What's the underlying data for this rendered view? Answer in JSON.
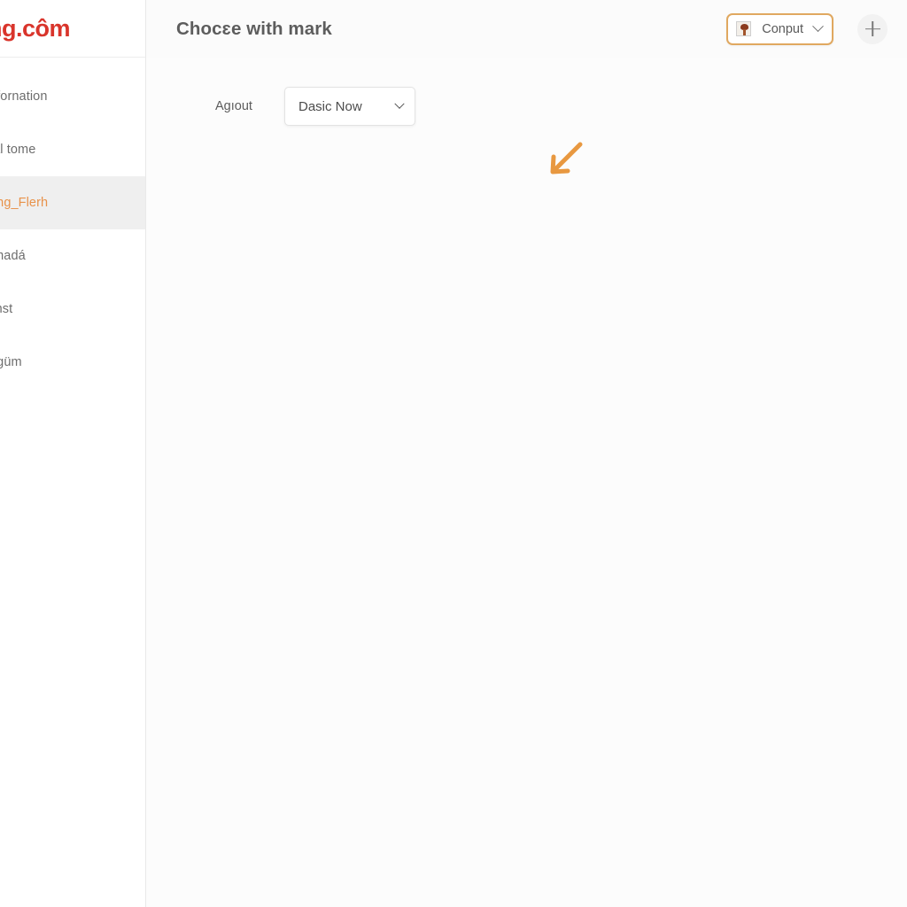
{
  "brand": {
    "logo_text": "ng.côm",
    "logo_color": "#d9342b"
  },
  "sidebar": {
    "items": [
      {
        "label": "nfornation",
        "active": false
      },
      {
        "label": "ıal tome",
        "active": false
      },
      {
        "label": "ung_Flerh",
        "active": true
      },
      {
        "label": "ımadá",
        "active": false
      },
      {
        "label": "linst",
        "active": false
      },
      {
        "label": "ogüm",
        "active": false
      }
    ],
    "active_color": "#e8924a",
    "active_background": "#efefef"
  },
  "topbar": {
    "page_title": "Chocɛe with mark",
    "context_select": {
      "label": "Conput",
      "icon": "image-thumbnail-icon",
      "chevron": "chevron-down-icon",
      "focus_ring_color": "#e0a860"
    },
    "add_button": {
      "icon": "plus-icon"
    }
  },
  "content": {
    "field": {
      "label": "Agıout",
      "select_value": "Dasic Now",
      "chevron": "chevron-down-icon"
    },
    "annotation": {
      "icon": "arrow-down-left-icon",
      "color": "#e89840"
    }
  }
}
